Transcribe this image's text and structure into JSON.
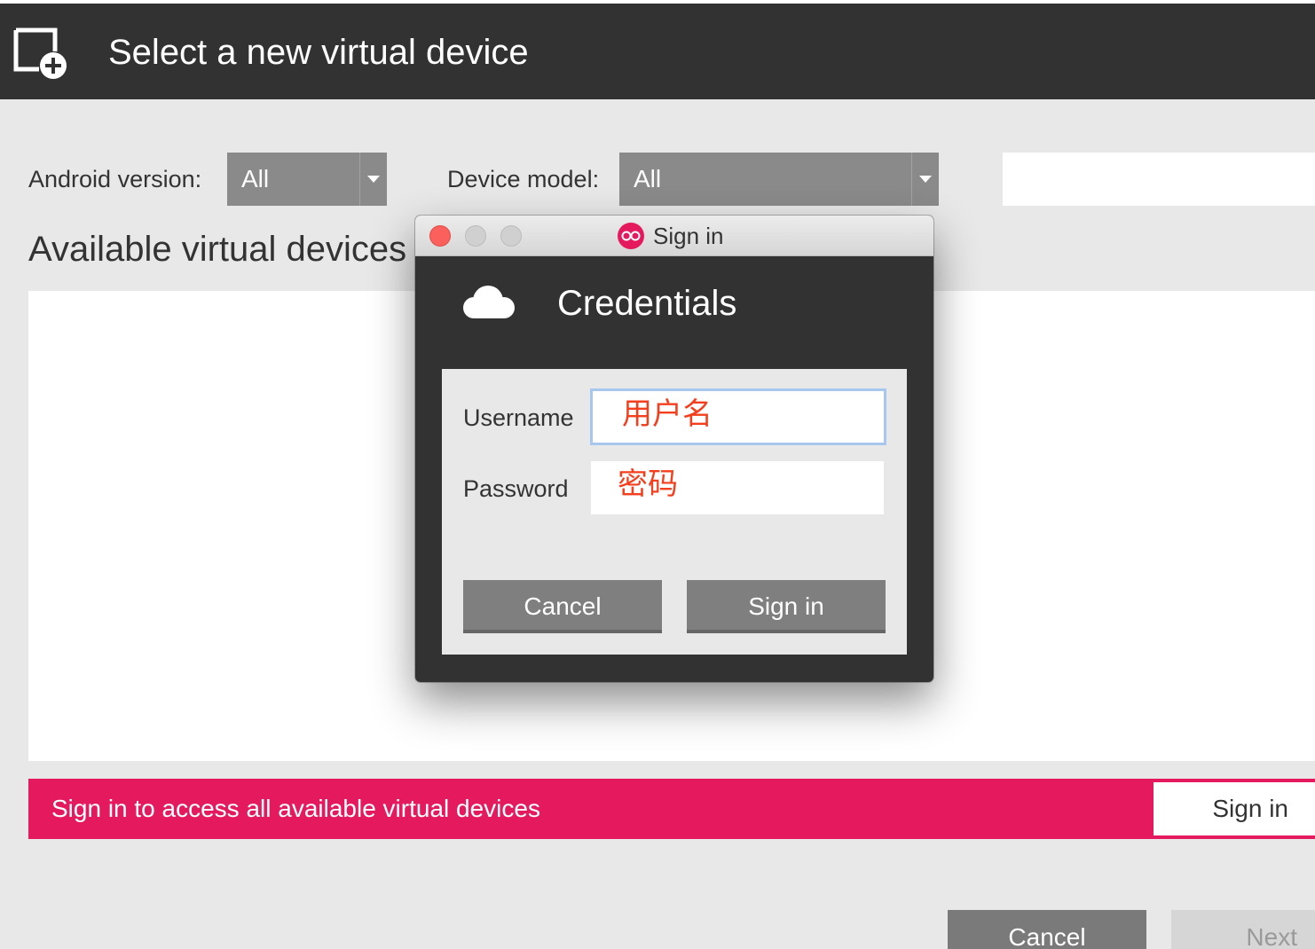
{
  "header": {
    "title": "Select a new virtual device",
    "icon": "add-device-icon"
  },
  "filters": {
    "android_version_label": "Android version:",
    "android_version_value": "All",
    "device_model_label": "Device model:",
    "device_model_value": "All"
  },
  "section_title": "Available virtual devices",
  "banner": {
    "text": "Sign in to access all available virtual devices",
    "button": "Sign in",
    "color": "#e5195d"
  },
  "footer": {
    "cancel": "Cancel",
    "next": "Next"
  },
  "dialog": {
    "window_title": "Sign in",
    "heading": "Credentials",
    "username_label": "Username",
    "username_value": "用户名",
    "password_label": "Password",
    "password_value": "密码",
    "cancel_button": "Cancel",
    "signin_button": "Sign in",
    "icons": [
      "cloud-icon",
      "genymotion-logo-icon"
    ]
  }
}
